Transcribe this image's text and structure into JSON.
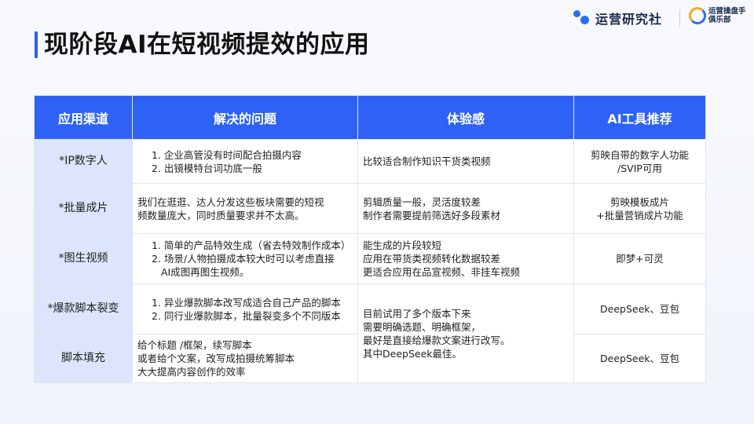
{
  "header": {
    "title": "现阶段AI在短视频提效的应用",
    "brand1": "运营研究社",
    "brand2_line1": "运营操盘手",
    "brand2_line2": "俱乐部"
  },
  "table": {
    "columns": [
      "应用渠道",
      "解决的问题",
      "体验感",
      "AI工具推荐"
    ],
    "rows": [
      {
        "channel": "*IP数字人",
        "problems": [
          "1.  企业高管没有时间配合拍摄内容",
          "2.  出镜模特台词功底一般"
        ],
        "experience": [
          "比较适合制作知识干货类视频"
        ],
        "tools": [
          "剪映自带的数字人功能",
          "/SVIP可用"
        ]
      },
      {
        "channel": "*批量成片",
        "problems": [
          "我们在逛逛、达人分发这些板块需要的短视",
          "频数量庞大，同时质量要求并不太高。"
        ],
        "experience": [
          "剪辑质量一般，灵活度较差",
          "制作者需要提前筛选好多段素材"
        ],
        "tools": [
          "剪映模板成片",
          "+批量营销成片功能"
        ]
      },
      {
        "channel": "*图生视频",
        "problems": [
          "1.  简单的产品特效生成（省去特效制作成本）",
          "2.  场景/人物拍摄成本较大时可以考虑直接",
          "AI成图再图生视频。"
        ],
        "experience": [
          "能生成的片段较短",
          "应用在带货类视频转化数据较差",
          "更适合应用在品宣视频、非挂车视频"
        ],
        "tools": [
          "即梦+可灵"
        ]
      },
      {
        "channel": "*爆款脚本裂变",
        "problems": [
          "1.  异业爆款脚本改写成适合自己产品的脚本",
          "2.  同行业爆款脚本，批量裂变多个不同版本"
        ],
        "experience": [
          "目前试用了多个版本下来",
          "需要明确选题、明确框架，",
          "最好是直接给爆款文案进行改写。",
          "其中DeepSeek最佳。"
        ],
        "tools": [
          "DeepSeek、豆包"
        ]
      },
      {
        "channel": "脚本填充",
        "problems": [
          "给个标题 /框架，续写脚本",
          "或者给个文案，改写成拍摄统筹脚本",
          "大大提高内容创作的效率"
        ],
        "tools": [
          "DeepSeek、豆包"
        ]
      }
    ]
  }
}
